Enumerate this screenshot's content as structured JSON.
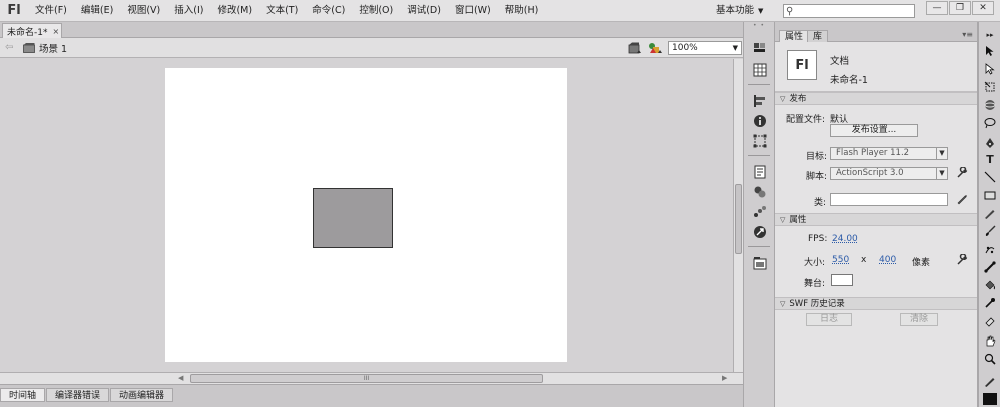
{
  "app": {
    "logo": "Fl",
    "menu": [
      "文件(F)",
      "编辑(E)",
      "视图(V)",
      "插入(I)",
      "修改(M)",
      "文本(T)",
      "命令(C)",
      "控制(O)",
      "调试(D)",
      "窗口(W)",
      "帮助(H)"
    ],
    "workspace_label": "基本功能",
    "search_placeholder": "",
    "window_controls": [
      "—",
      "❐",
      "✕"
    ]
  },
  "document": {
    "tab_label": "未命名-1*",
    "tab_close": "×",
    "scene_label": "场景 1",
    "zoom_value": "100%",
    "stage_color": "#ffffff",
    "shape_color": "#9d9b9d"
  },
  "scroll": {
    "h_grip": "III"
  },
  "bottom_tabs": [
    "时间轴",
    "编译器错误",
    "动画编辑器"
  ],
  "properties": {
    "tabs": [
      "属性",
      "库"
    ],
    "doc_badge": "Fl",
    "doc_type": "文档",
    "doc_name": "未命名-1",
    "publish": {
      "header": "发布",
      "profile_label": "配置文件:",
      "profile_value": "默认",
      "settings_button": "发布设置...",
      "target_label": "目标:",
      "target_value": "Flash Player 11.2",
      "script_label": "脚本:",
      "script_value": "ActionScript 3.0",
      "class_label": "类:",
      "class_value": ""
    },
    "props": {
      "header": "属性",
      "fps_label": "FPS:",
      "fps_value": "24.00",
      "size_label": "大小:",
      "width": "550",
      "size_x": "x",
      "height": "400",
      "unit": "像素",
      "stage_label": "舞台:",
      "stage_color": "#ffffff"
    },
    "swf": {
      "header": "SWF 历史记录",
      "log_button": "日志",
      "clear_button": "清除"
    }
  }
}
